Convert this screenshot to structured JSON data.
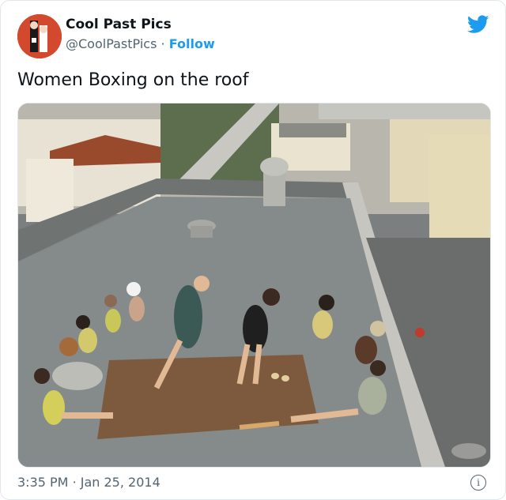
{
  "author": {
    "name": "Cool Past Pics",
    "handle": "@CoolPastPics",
    "separator": "·",
    "follow_label": "Follow"
  },
  "tweet": {
    "text": "Women Boxing on the roof"
  },
  "footer": {
    "time": "3:35 PM",
    "separator": "·",
    "date": "Jan 25, 2014",
    "info_glyph": "i"
  },
  "icons": {
    "brand": "twitter-bird-icon",
    "info": "info-icon"
  },
  "colors": {
    "accent": "#1d9bf0",
    "secondary_text": "#536471",
    "border": "#e1e8ed"
  }
}
